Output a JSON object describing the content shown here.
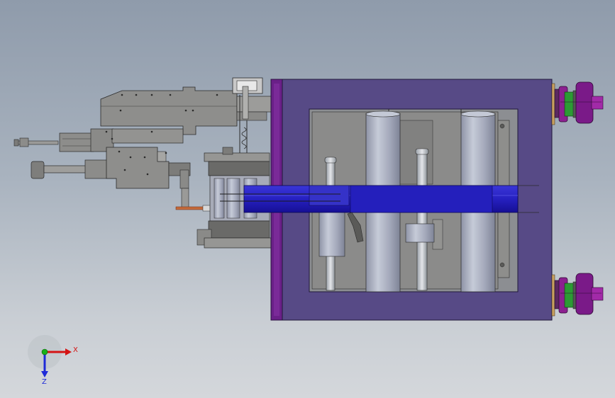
{
  "viewport": {
    "background_top": "#8f9bab",
    "background_bottom": "#d4d7db"
  },
  "model": {
    "frame_color": "#574a86",
    "flange_color": "#6a2088",
    "slider_color": "#1e18b8",
    "cylinder_color": "#a8aebf",
    "body_color": "#8a8a88",
    "bolt_color": "#8c2090"
  },
  "triad": {
    "x_label": "X",
    "z_label": "Z",
    "x_color": "#d41414",
    "y_color": "#18b018",
    "z_color": "#1e2ad8"
  }
}
